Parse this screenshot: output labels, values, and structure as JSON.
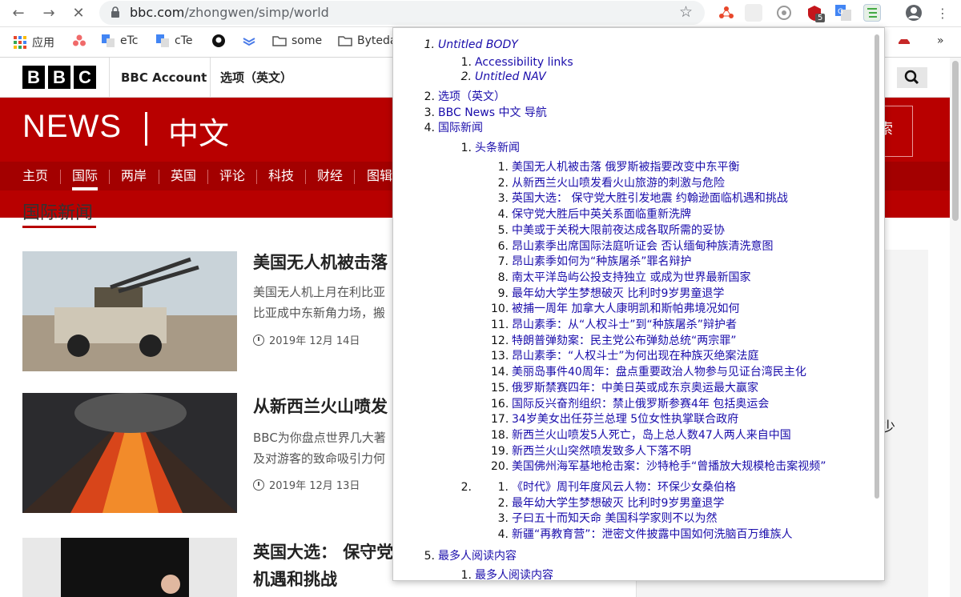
{
  "browser": {
    "url_host": "bbc.com",
    "url_path": "/zhongwen/simp/world",
    "ext_badge": "5",
    "bookmarks": [
      {
        "label": "应用",
        "icon": "apps-grid-icon"
      },
      {
        "label": "",
        "icon": "asana-icon"
      },
      {
        "label": "eTc",
        "icon": "google-translate-icon"
      },
      {
        "label": "cTe",
        "icon": "google-translate-icon"
      },
      {
        "label": "",
        "icon": "github-icon"
      },
      {
        "label": "",
        "icon": "layers-icon"
      },
      {
        "label": "some",
        "icon": "folder-icon"
      },
      {
        "label": "Byteda",
        "icon": "folder-icon"
      }
    ],
    "more_bookmarks": "»"
  },
  "bbc": {
    "logo_letters": [
      "B",
      "B",
      "C"
    ],
    "account": "BBC Account",
    "options": "选项（英文）",
    "news": "NEWS",
    "chinese": "中文",
    "red_box_text": "索",
    "nav": [
      "主页",
      "国际",
      "两岸",
      "英国",
      "评论",
      "科技",
      "财经",
      "图辑"
    ],
    "section_title": "国际新闻",
    "side_partial": "少",
    "stories": [
      {
        "head": "美国无人机被击落",
        "summary": [
          "美国无人机上月在利比亚",
          "比亚成中东新角力场，搬"
        ],
        "time": "2019年 12月 14日"
      },
      {
        "head": "从新西兰火山喷发",
        "summary": [
          "BBC为你盘点世界几大著",
          "及对游客的致命吸引力何"
        ],
        "time": "2019年 12月 13日"
      },
      {
        "head": "英国大选： 保守党",
        "summary": [
          "机遇和挑战"
        ],
        "time": ""
      }
    ]
  },
  "outline": {
    "l1": [
      {
        "n": "1.",
        "label": "Untitled BODY",
        "italic": true
      },
      {
        "n": "2.",
        "label": "选项（英文）"
      },
      {
        "n": "3.",
        "label": "BBC News 中文 导航"
      },
      {
        "n": "4.",
        "label": "国际新闻"
      },
      {
        "n": "5.",
        "label": "最多人阅读内容"
      }
    ],
    "body_children": [
      {
        "n": "1.",
        "label": "Accessibility links"
      },
      {
        "n": "2.",
        "label": "Untitled NAV",
        "italic": true
      }
    ],
    "intl_children": [
      {
        "n": "1.",
        "label": "头条新闻"
      },
      {
        "n": "2.",
        "label": ""
      }
    ],
    "headlines": [
      "美国无人机被击落 俄罗斯被指要改变中东平衡",
      "从新西兰火山喷发看火山旅游的刺激与危险",
      "英国大选： 保守党大胜引发地震 约翰逊面临机遇和挑战",
      "保守党大胜后中英关系面临重新洗牌",
      "中美或于关税大限前夜达成各取所需的妥协",
      "昂山素季出席国际法庭听证会 否认缅甸种族清洗意图",
      "昂山素季如何为“种族屠杀”罪名辩护",
      "南太平洋岛屿公投支持独立 或成为世界最新国家",
      "最年幼大学生梦想破灭 比利时9岁男童退学",
      "被捕一周年 加拿大人康明凯和斯帕弗境况如何",
      "昂山素季：从“人权斗士”到“种族屠杀”辩护者",
      "特朗普弹劾案：民主党公布弹劾总统“两宗罪”",
      "昂山素季：“人权斗士”为何出现在种族灭绝案法庭",
      "美丽岛事件40周年：盘点重要政治人物参与见证台湾民主化",
      "俄罗斯禁赛四年：中美日英或成东京奥运最大赢家",
      "国际反兴奋剂组织：禁止俄罗斯参赛4年 包括奥运会",
      "34岁美女出任芬兰总理 5位女性执掌联合政府",
      "新西兰火山喷发5人死亡，岛上总人数47人两人来自中国",
      "新西兰火山突然喷发致多人下落不明",
      "美国佛州海军基地枪击案：沙特枪手“曾播放大规模枪击案视频”"
    ],
    "second_list": [
      "《时代》周刊年度风云人物：环保少女桑伯格",
      "最年幼大学生梦想破灭 比利时9岁男童退学",
      "子曰五十而知天命 美国科学家则不以为然",
      "新疆“再教育营”：泄密文件披露中国如何洗脑百万维族人"
    ],
    "most_read_child": {
      "n": "1.",
      "label": "最多人阅读内容"
    }
  }
}
